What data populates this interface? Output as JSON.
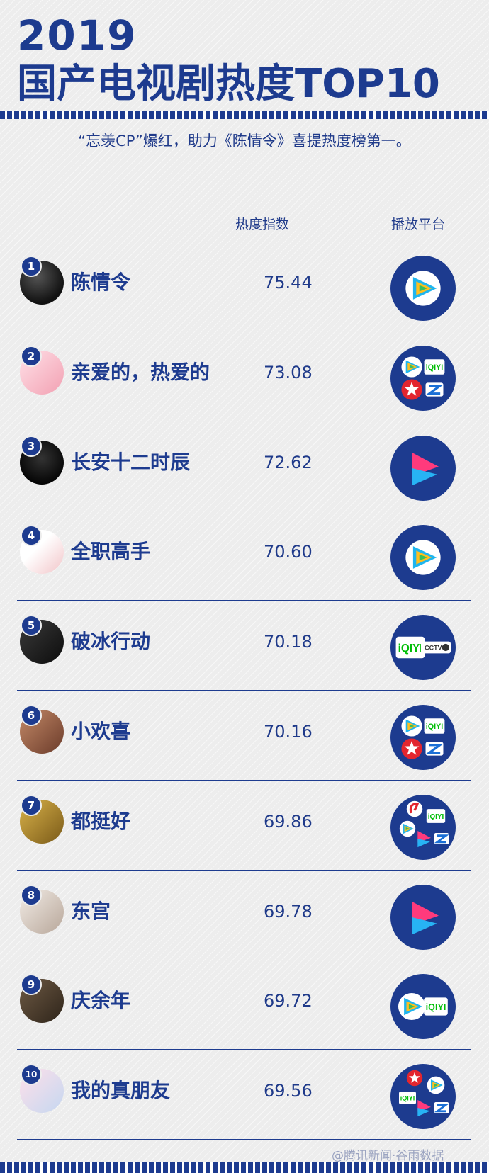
{
  "header": {
    "year": "2019",
    "title": "国产电视剧热度TOP10",
    "subtitle": "“忘羡CP”爆红，助力《陈情令》喜提热度榜第一。"
  },
  "columns": {
    "heat": "热度指数",
    "platform": "播放平台"
  },
  "colors": {
    "brand_navy": "#1d3b8f",
    "background": "#ededed"
  },
  "rows": [
    {
      "rank": "1",
      "name": "陈情令",
      "score": "75.44",
      "platforms": [
        "tencent"
      ]
    },
    {
      "rank": "2",
      "name": "亲爱的，热爱的",
      "score": "73.08",
      "platforms": [
        "tencent",
        "iqiyi",
        "dragon-tv",
        "zhejiang-tv"
      ]
    },
    {
      "rank": "3",
      "name": "长安十二时辰",
      "score": "72.62",
      "platforms": [
        "youku"
      ]
    },
    {
      "rank": "4",
      "name": "全职高手",
      "score": "70.60",
      "platforms": [
        "tencent"
      ]
    },
    {
      "rank": "5",
      "name": "破冰行动",
      "score": "70.18",
      "platforms": [
        "iqiyi",
        "cctv8"
      ]
    },
    {
      "rank": "6",
      "name": "小欢喜",
      "score": "70.16",
      "platforms": [
        "tencent",
        "iqiyi",
        "dragon-tv",
        "zhejiang-tv"
      ]
    },
    {
      "rank": "7",
      "name": "都挺好",
      "score": "69.86",
      "platforms": [
        "jiangsu-tv",
        "iqiyi",
        "tencent",
        "youku",
        "zhejiang-tv"
      ]
    },
    {
      "rank": "8",
      "name": "东宫",
      "score": "69.78",
      "platforms": [
        "youku"
      ]
    },
    {
      "rank": "9",
      "name": "庆余年",
      "score": "69.72",
      "platforms": [
        "tencent",
        "iqiyi"
      ]
    },
    {
      "rank": "10",
      "name": "我的真朋友",
      "score": "69.56",
      "platforms": [
        "dragon-tv",
        "tencent",
        "iqiyi",
        "youku",
        "zhejiang-tv"
      ]
    }
  ],
  "watermark": "@腾讯新闻·谷雨数据"
}
